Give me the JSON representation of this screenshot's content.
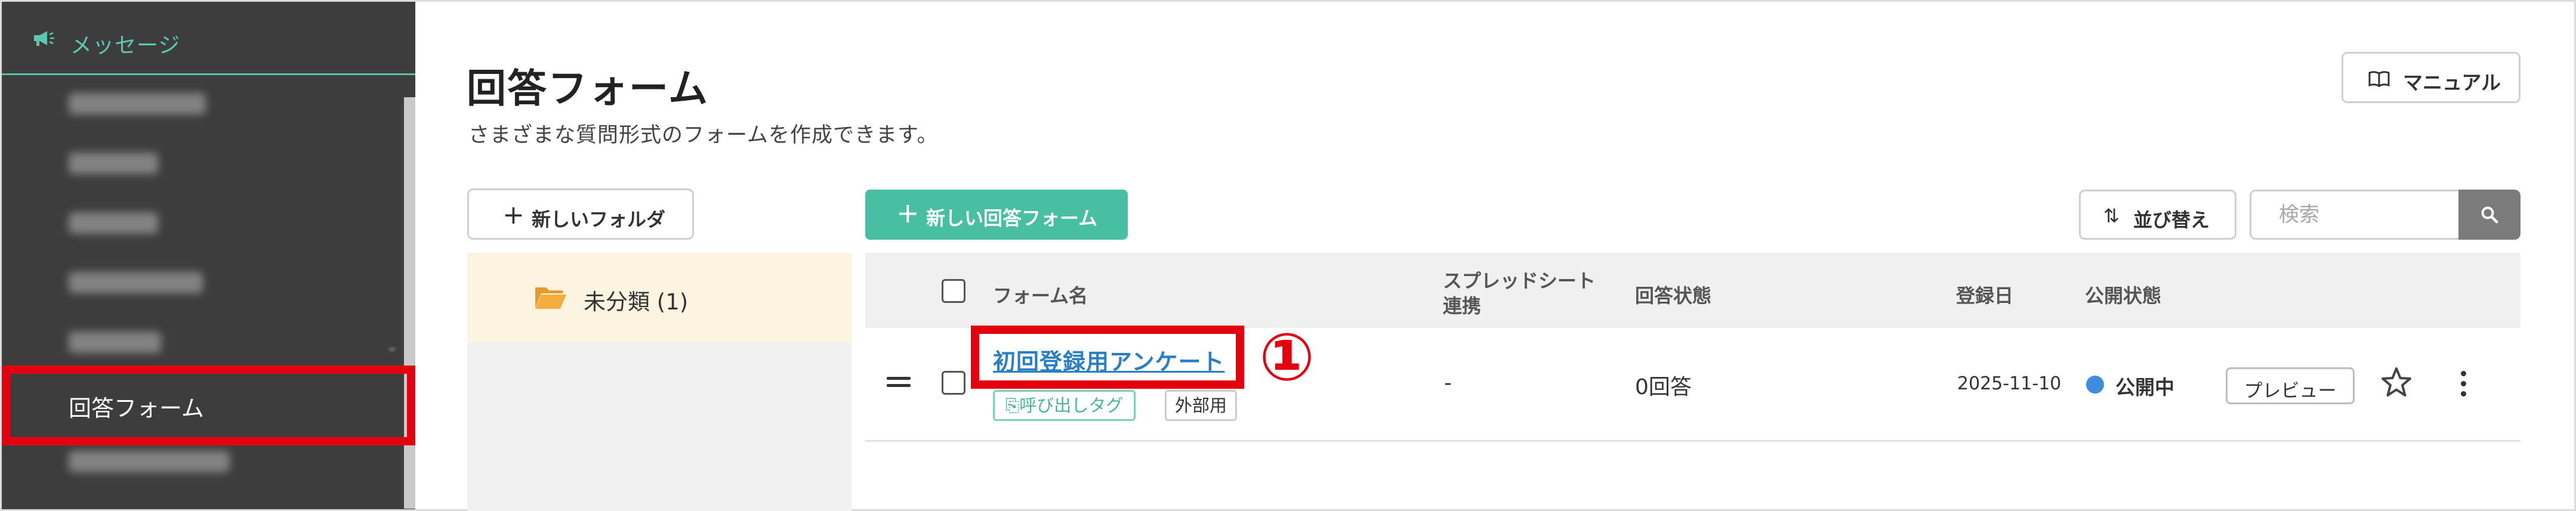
{
  "sidebar": {
    "section_label": "メッセージ",
    "items": [
      {
        "name": "sidebar-item-scenario",
        "label": "",
        "obscured": true
      },
      {
        "name": "sidebar-item-broadcast",
        "label": "",
        "obscured": true
      },
      {
        "name": "sidebar-item-auto-reply",
        "label": "",
        "obscured": true
      },
      {
        "name": "sidebar-item-template",
        "label": "",
        "obscured": true
      },
      {
        "name": "sidebar-item-scheduled",
        "label": "",
        "obscured": true
      },
      {
        "name": "sidebar-item-answer-form",
        "label": "回答フォーム",
        "active": true
      },
      {
        "name": "sidebar-item-reminder",
        "label": "",
        "obscured": true
      }
    ]
  },
  "header": {
    "title": "回答フォーム",
    "subtitle": "さまざまな質問形式のフォームを作成できます。",
    "manual_label": "マニュアル"
  },
  "folders": {
    "new_folder_label": "新しいフォルダ",
    "items": [
      {
        "label": "未分類 (1)"
      }
    ]
  },
  "toolbar": {
    "new_form_label": "新しい回答フォーム",
    "sort_label": "並び替え",
    "search_placeholder": "検索"
  },
  "table": {
    "columns": {
      "form_name": "フォーム名",
      "spreadsheet_line1": "スプレッドシート",
      "spreadsheet_line2": "連携",
      "answer_status": "回答状態",
      "registered_date": "登録日",
      "publish_status": "公開状態"
    },
    "rows": [
      {
        "form_name": "初回登録用アンケート",
        "tag_call": "呼び出しタグ",
        "tag_external": "外部用",
        "spreadsheet": "-",
        "answers": "0回答",
        "registered": "2025-11-10",
        "publish_status": "公開中",
        "preview_label": "プレビュー"
      }
    ]
  },
  "annotations": {
    "step_marker": "①",
    "highlight_color": "#e3000f"
  },
  "colors": {
    "accent": "#48bfa3",
    "sidebar_bg": "#3d3d3d",
    "link": "#2a7fc4",
    "status_dot": "#3c8de0"
  }
}
